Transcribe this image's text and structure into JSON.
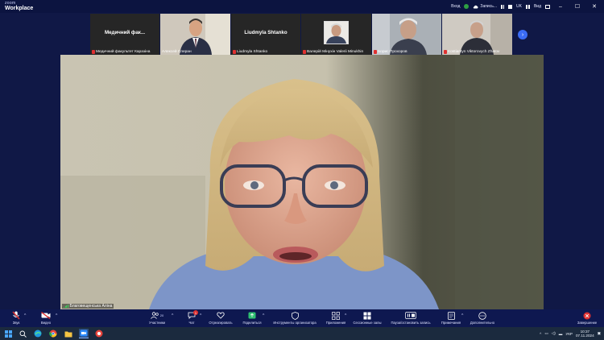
{
  "app": {
    "logo_small": "zoom",
    "logo_title": "Workplace"
  },
  "titlebar": {
    "signin": "Вход",
    "recording": "Запись...",
    "language": "UK",
    "view": "Вид"
  },
  "thumbnails": [
    {
      "label": "Медичний  фак...",
      "name": "Медичний факультет Каразіна"
    },
    {
      "label": "",
      "name": "Алексей Сперан"
    },
    {
      "label": "Liudmyla Shtanko",
      "name": "Liudmyla Shtanko"
    },
    {
      "label": "",
      "name": "Валерій Мінухін Valerii Minukhin"
    },
    {
      "label": "",
      "name": "Борис Прохоров"
    },
    {
      "label": "",
      "name": "Kostiantyn Viktorovych Zhatov"
    }
  ],
  "main": {
    "speaker_name": "Благовещенська Аліна"
  },
  "toolbar": {
    "items": [
      {
        "label": "Звук",
        "icon": "microphone-icon"
      },
      {
        "label": "Видео",
        "icon": "video-icon"
      },
      {
        "label": "Участники",
        "icon": "participants-icon",
        "count": "20"
      },
      {
        "label": "Чат",
        "icon": "chat-icon",
        "badge": "1"
      },
      {
        "label": "Отреагировать",
        "icon": "heart-icon"
      },
      {
        "label": "Поделиться",
        "icon": "share-icon"
      },
      {
        "label": "Инструменты организатора",
        "icon": "shield-icon"
      },
      {
        "label": "Приложения",
        "icon": "apps-icon"
      },
      {
        "label": "Сессионные залы",
        "icon": "rooms-icon"
      },
      {
        "label": "Пауза/остановить запись",
        "icon": "pause-stop-icon"
      },
      {
        "label": "Примечания",
        "icon": "notes-icon"
      },
      {
        "label": "Дополнительно",
        "icon": "more-icon"
      },
      {
        "label": "Завершение",
        "icon": "close-icon"
      }
    ]
  },
  "taskbar": {
    "lang": "УКР",
    "time": "10:37",
    "date": "07.11.2024"
  },
  "colors": {
    "accent": "#3b6cf5",
    "mic_off": "#e03131",
    "end": "#e03131",
    "recording": "#2ea043"
  }
}
